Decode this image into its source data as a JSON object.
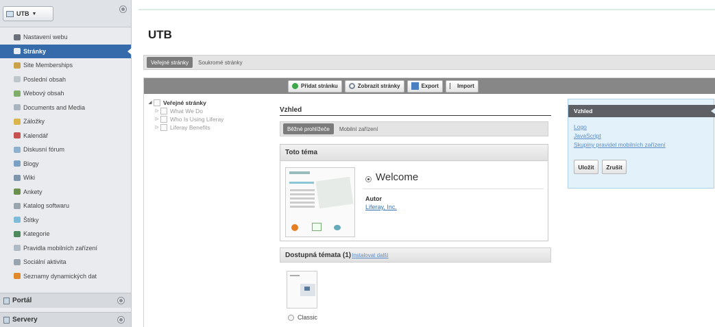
{
  "site_selector": {
    "label": "UTB",
    "caret": "▼"
  },
  "sidebar": {
    "items": [
      {
        "label": "Nastavení webu",
        "icon": "gear-icon",
        "color": "#6c7179"
      },
      {
        "label": "Stránky",
        "icon": "pages-icon",
        "color": "#e8eef5",
        "active": true
      },
      {
        "label": "Site Memberships",
        "icon": "users-icon",
        "color": "#c9a24a"
      },
      {
        "label": "Poslední obsah",
        "icon": "recent-content-icon",
        "color": "#bfc6cc"
      },
      {
        "label": "Webový obsah",
        "icon": "web-content-icon",
        "color": "#7fae6b"
      },
      {
        "label": "Documents and Media",
        "icon": "folder-icon",
        "color": "#a9b4bf"
      },
      {
        "label": "Záložky",
        "icon": "bookmarks-icon",
        "color": "#d8b44a"
      },
      {
        "label": "Kalendář",
        "icon": "calendar-icon",
        "color": "#c75050"
      },
      {
        "label": "Diskusní fórum",
        "icon": "forum-icon",
        "color": "#8eb1cf"
      },
      {
        "label": "Blogy",
        "icon": "blogs-icon",
        "color": "#7aa0c4"
      },
      {
        "label": "Wiki",
        "icon": "wiki-icon",
        "color": "#7e95ad"
      },
      {
        "label": "Ankety",
        "icon": "polls-icon",
        "color": "#6b8f4e"
      },
      {
        "label": "Katalog softwaru",
        "icon": "software-catalog-icon",
        "color": "#9aa4ad"
      },
      {
        "label": "Štítky",
        "icon": "tags-icon",
        "color": "#7dbbd9"
      },
      {
        "label": "Kategorie",
        "icon": "categories-icon",
        "color": "#4f8a5e"
      },
      {
        "label": "Pravidla mobilních zařízení",
        "icon": "mobile-rules-icon",
        "color": "#b0bac4"
      },
      {
        "label": "Sociální aktivita",
        "icon": "social-activity-icon",
        "color": "#9aa4ad"
      },
      {
        "label": "Seznamy dynamických dat",
        "icon": "dynamic-data-lists-icon",
        "color": "#e08a2c"
      }
    ],
    "sections": [
      {
        "label": "Portál",
        "icon": "portal-icon"
      },
      {
        "label": "Servery",
        "icon": "server-icon"
      }
    ]
  },
  "main": {
    "title": "UTB",
    "tabs": [
      {
        "label": "Veřejné stránky",
        "selected": true
      },
      {
        "label": "Soukromé stránky",
        "selected": false
      }
    ],
    "toolbar": {
      "add_page": "Přidat stránku",
      "view_pages": "Zobrazit stránky",
      "export": "Export",
      "import": "Import"
    },
    "tree": {
      "root": "Veřejné stránky",
      "children": [
        "What We Do",
        "Who Is Using Liferay",
        "Liferay Benefits"
      ]
    },
    "vzhled": {
      "heading": "Vzhled",
      "device_tabs": [
        {
          "label": "Běžné prohlížeče",
          "selected": true
        },
        {
          "label": "Mobilní zařízení",
          "selected": false
        }
      ],
      "current_theme": {
        "heading": "Toto téma",
        "name": "Welcome",
        "author_label": "Autor",
        "author": "Liferay, Inc."
      },
      "available": {
        "heading": "Dostupná témata (1)",
        "install_more": "Instalovat další",
        "themes": [
          "Classic"
        ]
      }
    },
    "right_panel": {
      "heading": "Vzhled",
      "links": [
        "Logo",
        "JavaScript",
        "Skupiny pravidel mobilních zařízení"
      ],
      "save": "Uložit",
      "cancel": "Zrušit"
    }
  },
  "colors": {
    "accent": "#356baa",
    "toolbar": "#878787",
    "link": "#5a8cc9"
  }
}
